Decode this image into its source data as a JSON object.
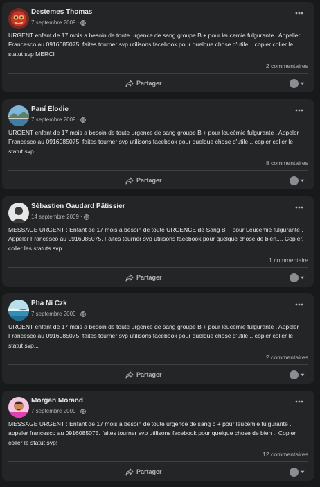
{
  "posts": [
    {
      "author": "Destemes Thomas",
      "date": "7 septembre 2009",
      "separator": "·",
      "avatar_colors": [
        "#c9342c",
        "#e8b463"
      ],
      "text": "URGENT enfant de 17 mois a besoin de toute urgence de sang groupe B + pour leucemie fulgurante . Appeller Francesco au 0916085075. faites tourner svp utilisons facebook pour quelque chose d'utile .. copier coller le statut svp MERCI",
      "comments": "2 commentaires",
      "share_label": "Partager"
    },
    {
      "author": "Paní Élodie",
      "date": "7 septembre 2009",
      "separator": "·",
      "avatar_colors": [
        "#7fb6d9",
        "#d8d0c0"
      ],
      "text": "URGENT enfant de 17 mois a besoin de toute urgence de sang groupe B + pour leucémie fulgurante . Appeler Francesco au 0916085075. faites tourner svp utilisons facebook pour quelque chose d'utile .. copier coller le statut svp...",
      "comments": "8 commentaires",
      "share_label": "Partager"
    },
    {
      "author": "Sébastien Gaudard Pâtissier",
      "date": "14 septembre 2009",
      "separator": "·",
      "avatar_colors": [
        "#e6e6e6",
        "#3a3a3a"
      ],
      "text": "MESSAGE URGENT : Enfant de 17 mois a besoin de toute URGENCE de Sang B + pour Leucémie fulgurante . Appeler Francesco au 0916085075. Faites tourner svp utilisons facebook pour quelque chose de bien.... Copier, coller les statuts svp.",
      "comments": "1 commentaire",
      "share_label": "Partager"
    },
    {
      "author": "Pha Ní Czk",
      "date": "7 septembre 2009",
      "separator": "·",
      "avatar_colors": [
        "#2f8fb8",
        "#b8e0ea"
      ],
      "text": "URGENT enfant de 17 mois a besoin de toute urgence de sang groupe B + pour leucémie fulgurante . Appeler Francesco au 0916085075. faites tourner svp utilisons facebook pour quelque chose d'utile .. copier coller le statut svp...",
      "comments": "2 commentaires",
      "share_label": "Partager"
    },
    {
      "author": "Morgan Morand",
      "date": "7 septembre 2009",
      "separator": "·",
      "avatar_colors": [
        "#e040b0",
        "#c98a5a"
      ],
      "text": "MESSAGE URGENT : Enfant de 17 mois a besoin de toute urgence de sang b + pour leucémie fulgurante . appeler francesco au 0916085075. faites tourner svp utilisons facebook pour quelque chose de bien .. Copier coller le statut svp!",
      "comments": "12 commentaires",
      "share_label": "Partager"
    }
  ],
  "colors": {
    "page_background": "#18191a",
    "card_background": "#242526",
    "primary_text": "#e4e6eb",
    "secondary_text": "#b0b3b8",
    "divider": "#3e4042"
  },
  "icons": {
    "privacy": "globe-icon",
    "menu": "more-icon",
    "share": "share-icon",
    "audience": "audience-avatar-icon",
    "dropdown": "chevron-down-icon"
  }
}
